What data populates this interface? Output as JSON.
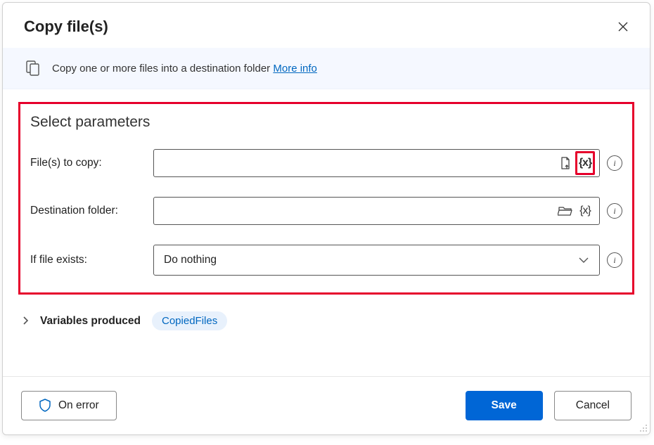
{
  "dialog": {
    "title": "Copy file(s)"
  },
  "info_bar": {
    "text": "Copy one or more files into a destination folder",
    "more_info_label": "More info"
  },
  "parameters": {
    "heading": "Select parameters",
    "files_to_copy": {
      "label": "File(s) to copy:",
      "value": ""
    },
    "destination_folder": {
      "label": "Destination folder:",
      "value": ""
    },
    "if_file_exists": {
      "label": "If file exists:",
      "value": "Do nothing"
    }
  },
  "variables": {
    "label": "Variables produced",
    "items": [
      "CopiedFiles"
    ]
  },
  "footer": {
    "on_error_label": "On error",
    "save_label": "Save",
    "cancel_label": "Cancel"
  }
}
